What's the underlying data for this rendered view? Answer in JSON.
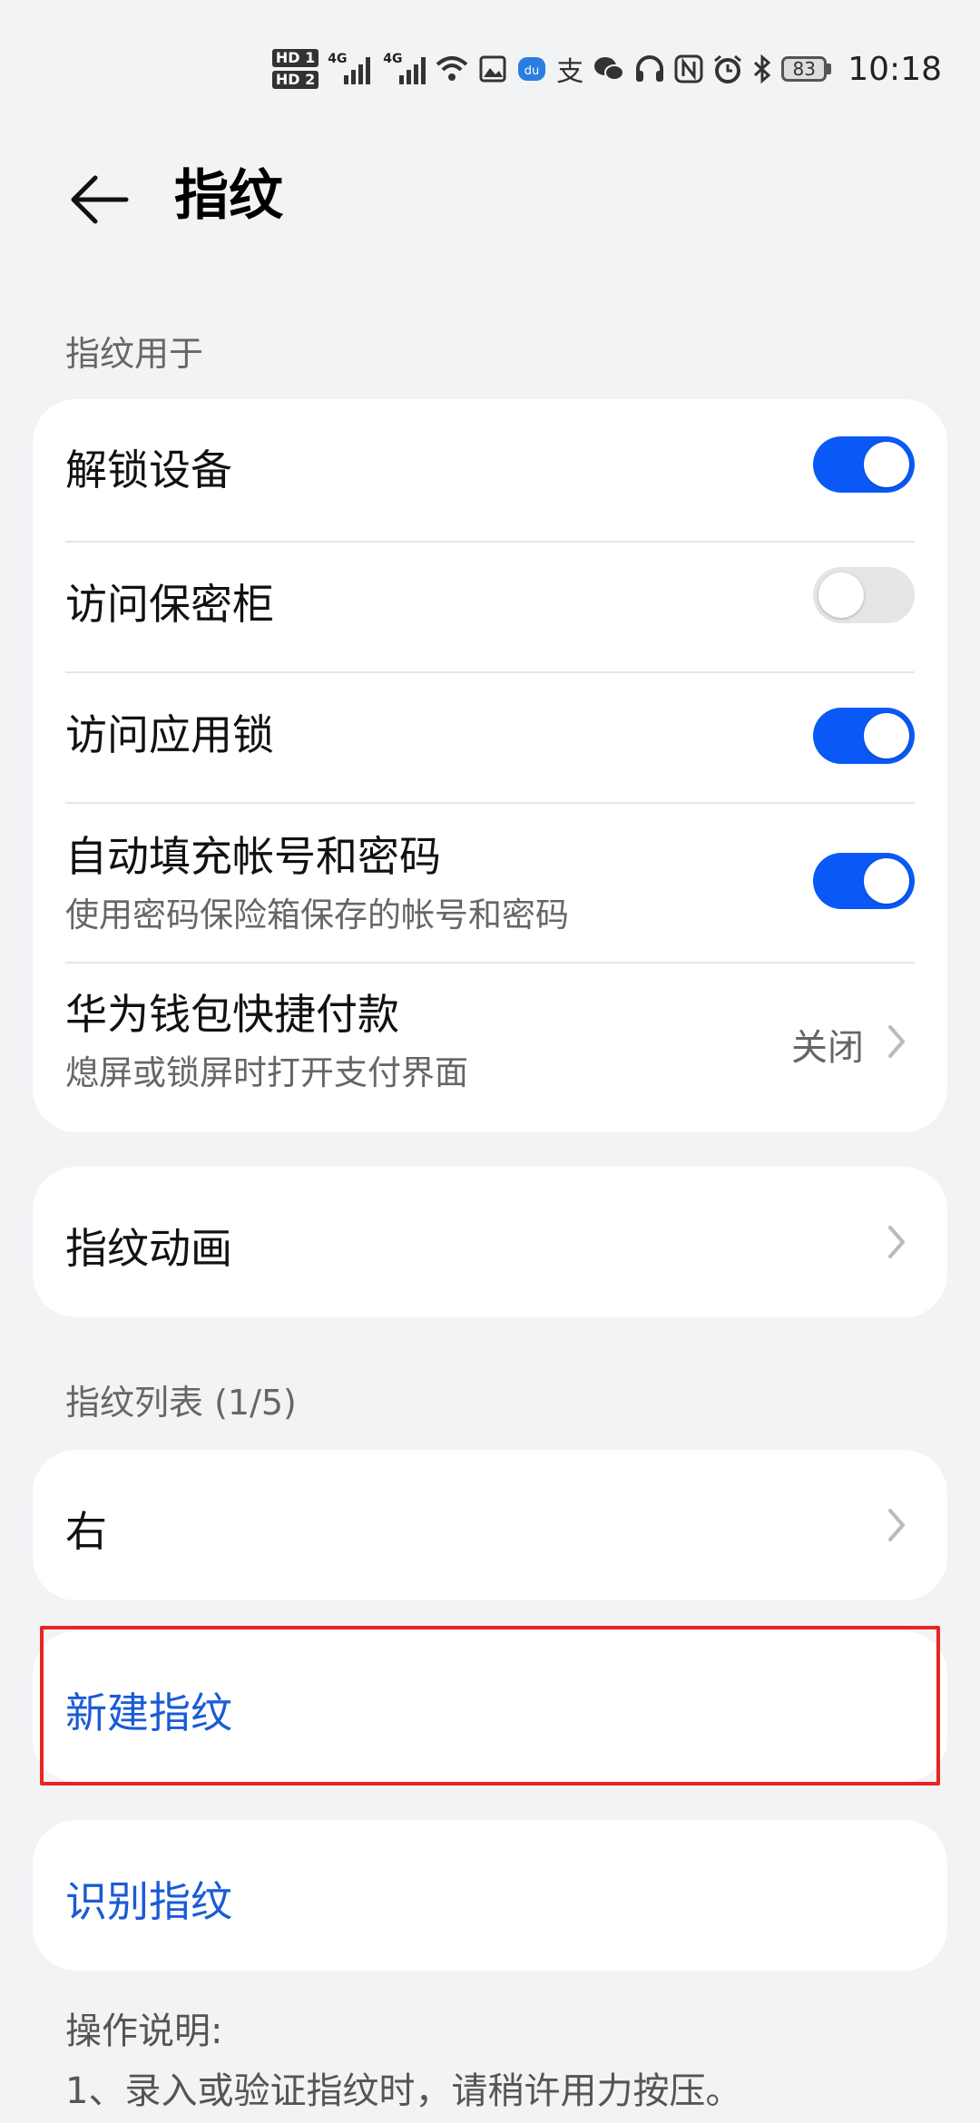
{
  "status_bar": {
    "hd1": "HD 1",
    "hd2": "HD 2",
    "net1": "4G",
    "net2": "4G",
    "battery": "83",
    "time": "10:18",
    "icons": [
      "wifi-icon",
      "image-icon",
      "baidu-icon",
      "alipay-icon",
      "wechat-icon",
      "headphones-icon",
      "nfc-icon",
      "alarm-icon",
      "bluetooth-icon"
    ]
  },
  "header": {
    "title": "指纹"
  },
  "section_usage": {
    "label": "指纹用于",
    "items": [
      {
        "title": "解锁设备",
        "toggle": true
      },
      {
        "title": "访问保密柜",
        "toggle": false
      },
      {
        "title": "访问应用锁",
        "toggle": true
      },
      {
        "title": "自动填充帐号和密码",
        "subtitle": "使用密码保险箱保存的帐号和密码",
        "toggle": true
      },
      {
        "title": "华为钱包快捷付款",
        "subtitle": "熄屏或锁屏时打开支付界面",
        "value": "关闭"
      }
    ]
  },
  "animation": {
    "title": "指纹动画"
  },
  "fingerprint_list": {
    "label": "指纹列表 (1/5)",
    "items": [
      {
        "title": "右"
      }
    ]
  },
  "actions": {
    "new_fingerprint": "新建指纹",
    "identify_fingerprint": "识别指纹"
  },
  "instructions": {
    "title": "操作说明:",
    "line1": "1、录入或验证指纹时，请稍许用力按压。"
  },
  "colors": {
    "accent": "#0A59F7",
    "link": "#1A5BD6",
    "background": "#F1F3F5",
    "highlight": "#E8261F"
  }
}
